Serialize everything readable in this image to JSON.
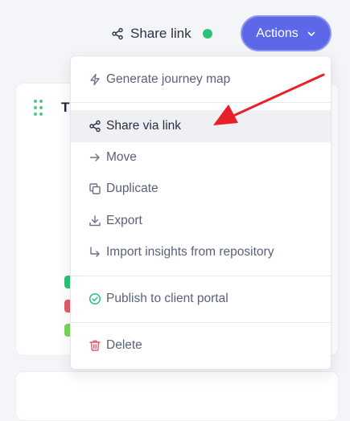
{
  "header": {
    "share_link_label": "Share link",
    "share_status_color": "#2cc17b",
    "actions_label": "Actions"
  },
  "card": {
    "title_initial": "T",
    "tag_colors": [
      "#2cc17b",
      "#e05a6a",
      "#7ad35a"
    ]
  },
  "menu": {
    "items": [
      {
        "label": "Generate journey map",
        "icon": "bolt-icon"
      },
      {
        "label": "Share via link",
        "icon": "share-icon"
      },
      {
        "label": "Move",
        "icon": "arrow-right-icon"
      },
      {
        "label": "Duplicate",
        "icon": "copy-icon"
      },
      {
        "label": "Export",
        "icon": "download-icon"
      },
      {
        "label": "Import insights from repository",
        "icon": "corner-down-right-icon"
      },
      {
        "label": "Publish to client portal",
        "icon": "check-circle-icon"
      },
      {
        "label": "Delete",
        "icon": "trash-icon"
      }
    ],
    "highlighted_item": "Share via link"
  },
  "colors": {
    "accent": "#5d68e8",
    "annotation_arrow": "#e8202a",
    "publish_icon": "#2cc17b",
    "delete_icon": "#e05a6a"
  }
}
